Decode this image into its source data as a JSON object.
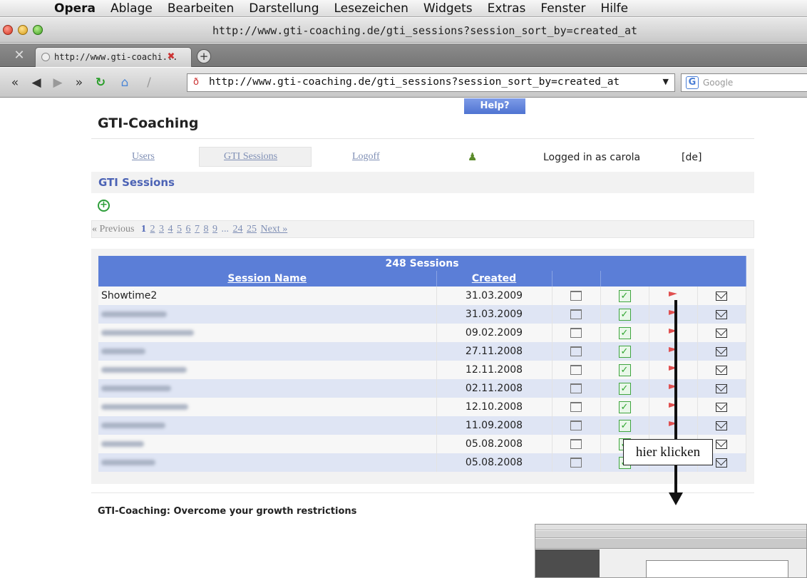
{
  "menubar": {
    "items": [
      "Opera",
      "Ablage",
      "Bearbeiten",
      "Darstellung",
      "Lesezeichen",
      "Widgets",
      "Extras",
      "Fenster",
      "Hilfe"
    ]
  },
  "window": {
    "title": "http://www.gti-coaching.de/gti_sessions?session_sort_by=created_at"
  },
  "tabbar": {
    "tab_label": "http://www.gti-coachi..."
  },
  "toolbar": {
    "url": "http://www.gti-coaching.de/gti_sessions?session_sort_by=created_at",
    "search_placeholder": "Google"
  },
  "page": {
    "help_label": "Help?",
    "brand": "GTI-Coaching",
    "nav": {
      "users": "Users",
      "sessions": "GTI Sessions",
      "logoff": "Logoff",
      "logged_in": "Logged in as carola",
      "lang": "[de]"
    },
    "section_title": "GTI Sessions",
    "pager": {
      "prev": "« Previous",
      "current": "1",
      "pages": [
        "2",
        "3",
        "4",
        "5",
        "6",
        "7",
        "8",
        "9"
      ],
      "ellipsis": "...",
      "last_pages": [
        "24",
        "25"
      ],
      "next": "Next »"
    },
    "table": {
      "count": "248 Sessions",
      "col_name": "Session Name",
      "col_created": "Created",
      "rows": [
        {
          "name": "Showtime2",
          "date": "31.03.2009"
        },
        {
          "name": "",
          "date": "31.03.2009"
        },
        {
          "name": "",
          "date": "09.02.2009"
        },
        {
          "name": "",
          "date": "27.11.2008"
        },
        {
          "name": "",
          "date": "12.11.2008"
        },
        {
          "name": "",
          "date": "02.11.2008"
        },
        {
          "name": "",
          "date": "12.10.2008"
        },
        {
          "name": "",
          "date": "11.09.2008"
        },
        {
          "name": "",
          "date": "05.08.2008"
        },
        {
          "name": "",
          "date": "05.08.2008"
        }
      ]
    },
    "footer": "GTI-Coaching: Overcome your growth restrictions"
  },
  "annotation": {
    "callout": "hier klicken"
  }
}
